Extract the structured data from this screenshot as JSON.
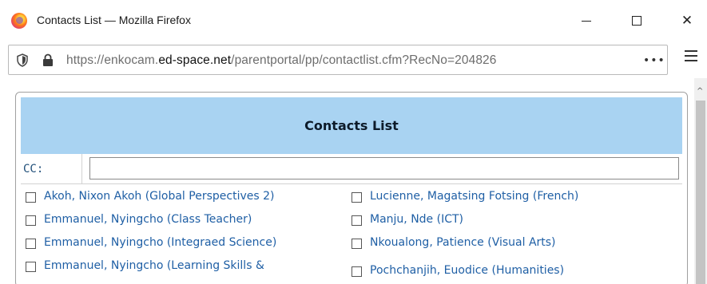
{
  "window": {
    "title": "Contacts List — Mozilla Firefox"
  },
  "browser": {
    "url_prefix": "https://enkocam.",
    "url_domain": "ed-space.net",
    "url_path": "/parentportal/pp/contactlist.cfm?RecNo=204826",
    "more_label": "•••"
  },
  "page": {
    "header_title": "Contacts List",
    "cc_label": "CC:",
    "cc_value": ""
  },
  "contacts_left": [
    {
      "label": "Akoh, Nixon Akoh (Global Perspectives 2)",
      "checked": false
    },
    {
      "label": "Emmanuel, Nyingcho (Class Teacher)",
      "checked": false
    },
    {
      "label": "Emmanuel, Nyingcho (Integraed Science)",
      "checked": false
    },
    {
      "label": "Emmanuel, Nyingcho (Learning Skills &",
      "checked": false
    }
  ],
  "contacts_right": [
    {
      "label": "Lucienne, Magatsing Fotsing (French)",
      "checked": false
    },
    {
      "label": "Manju, Nde (ICT)",
      "checked": false
    },
    {
      "label": "Nkoualong, Patience (Visual Arts)",
      "checked": false
    },
    {
      "label": "Pochchanjih, Euodice (Humanities)",
      "checked": false
    }
  ],
  "colors": {
    "header_bg": "#a9d3f2",
    "link": "#1f5fa5",
    "label": "#1f4e79"
  }
}
